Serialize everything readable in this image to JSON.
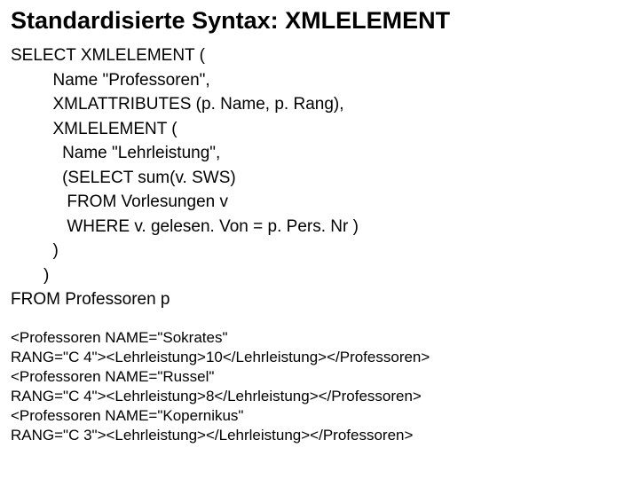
{
  "title": "Standardisierte Syntax: XMLELEMENT",
  "code": "SELECT XMLELEMENT (\n         Name \"Professoren\",\n         XMLATTRIBUTES (p. Name, p. Rang),\n         XMLELEMENT (\n           Name \"Lehrleistung\",\n           (SELECT sum(v. SWS)\n            FROM Vorlesungen v\n            WHERE v. gelesen. Von = p. Pers. Nr )\n         )\n       )\nFROM Professoren p",
  "output": "<Professoren NAME=\"Sokrates\"\nRANG=\"C 4\"><Lehrleistung>10</Lehrleistung></Professoren>\n<Professoren NAME=\"Russel\"\nRANG=\"C 4\"><Lehrleistung>8</Lehrleistung></Professoren>\n<Professoren NAME=\"Kopernikus\"\nRANG=\"C 3\"><Lehrleistung></Lehrleistung></Professoren>"
}
